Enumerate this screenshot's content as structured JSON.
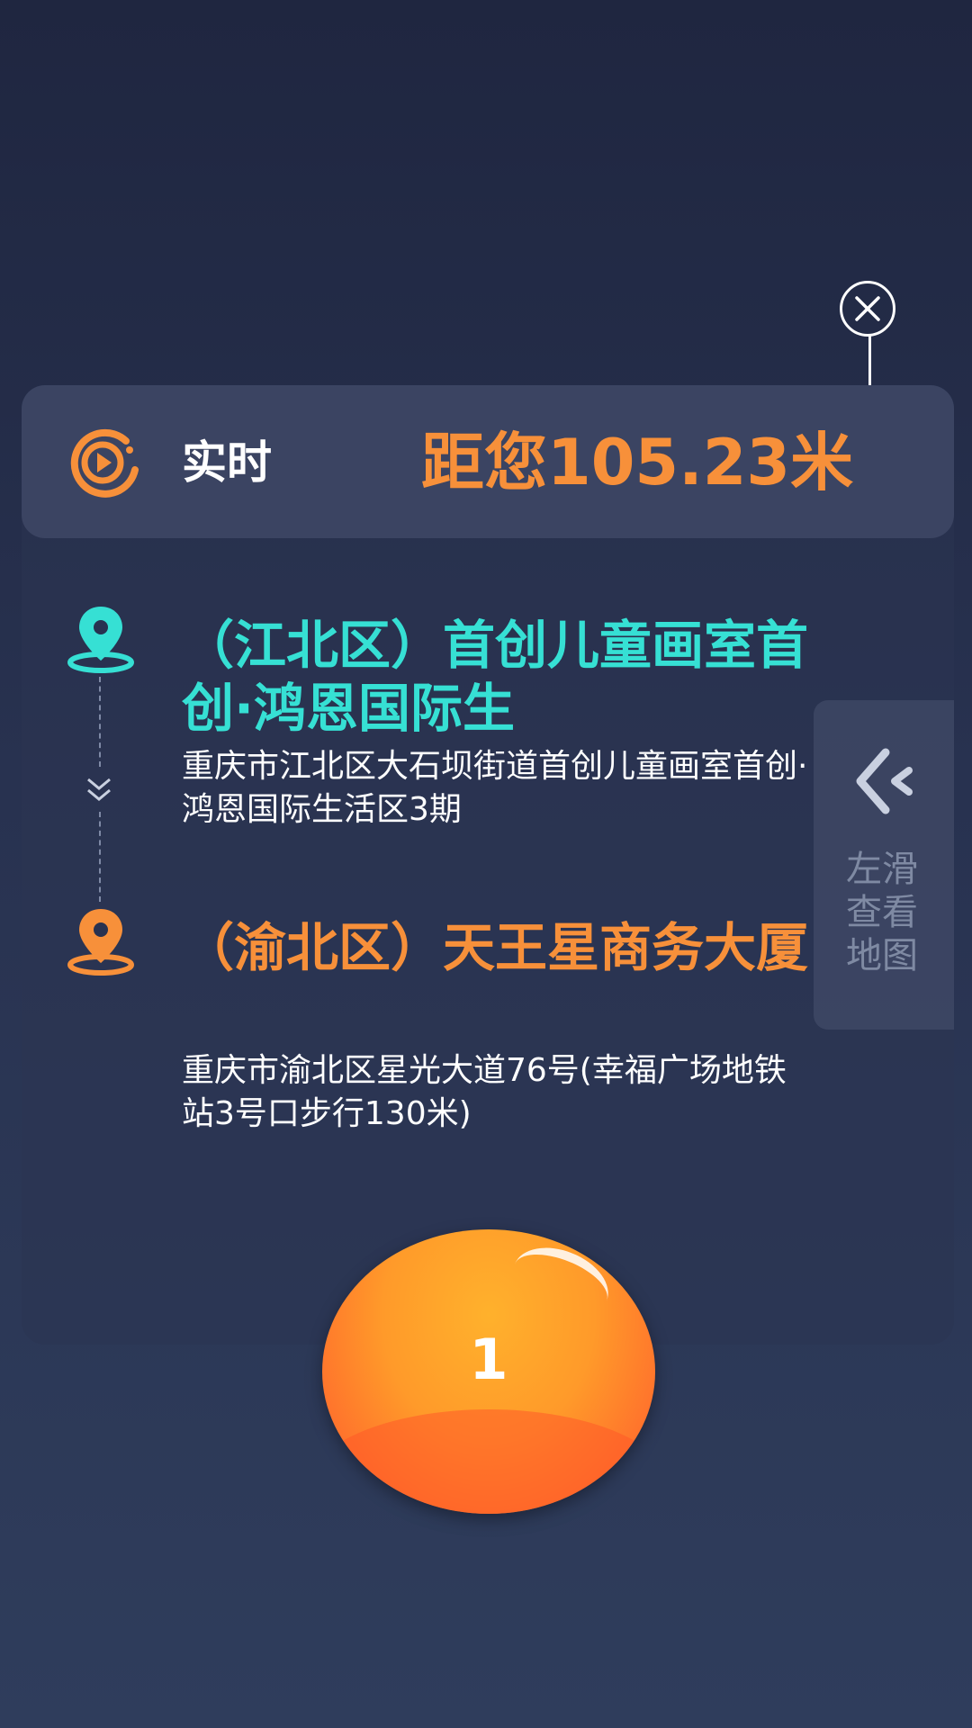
{
  "header": {
    "live_label": "实时",
    "distance_text": "距您105.23米"
  },
  "route": {
    "start": {
      "title": "（江北区）首创儿童画室首创·鸿恩国际生",
      "address": "重庆市江北区大石坝街道首创儿童画室首创·鸿恩国际生活区3期"
    },
    "end": {
      "title": "（渝北区）天王星商务大厦",
      "address": "重庆市渝北区星光大道76号(幸福广场地铁站3号口步行130米)"
    }
  },
  "swipe_hint": {
    "text": "左滑查看地图"
  },
  "ball": {
    "number": "1"
  },
  "colors": {
    "accent_orange": "#f7903a",
    "accent_cyan": "#36e0d4",
    "background": "#283250"
  },
  "icons": [
    "close-icon",
    "live-play-icon",
    "start-location-pin-icon",
    "end-location-pin-icon",
    "double-chevron-down-icon",
    "swipe-left-icon"
  ]
}
